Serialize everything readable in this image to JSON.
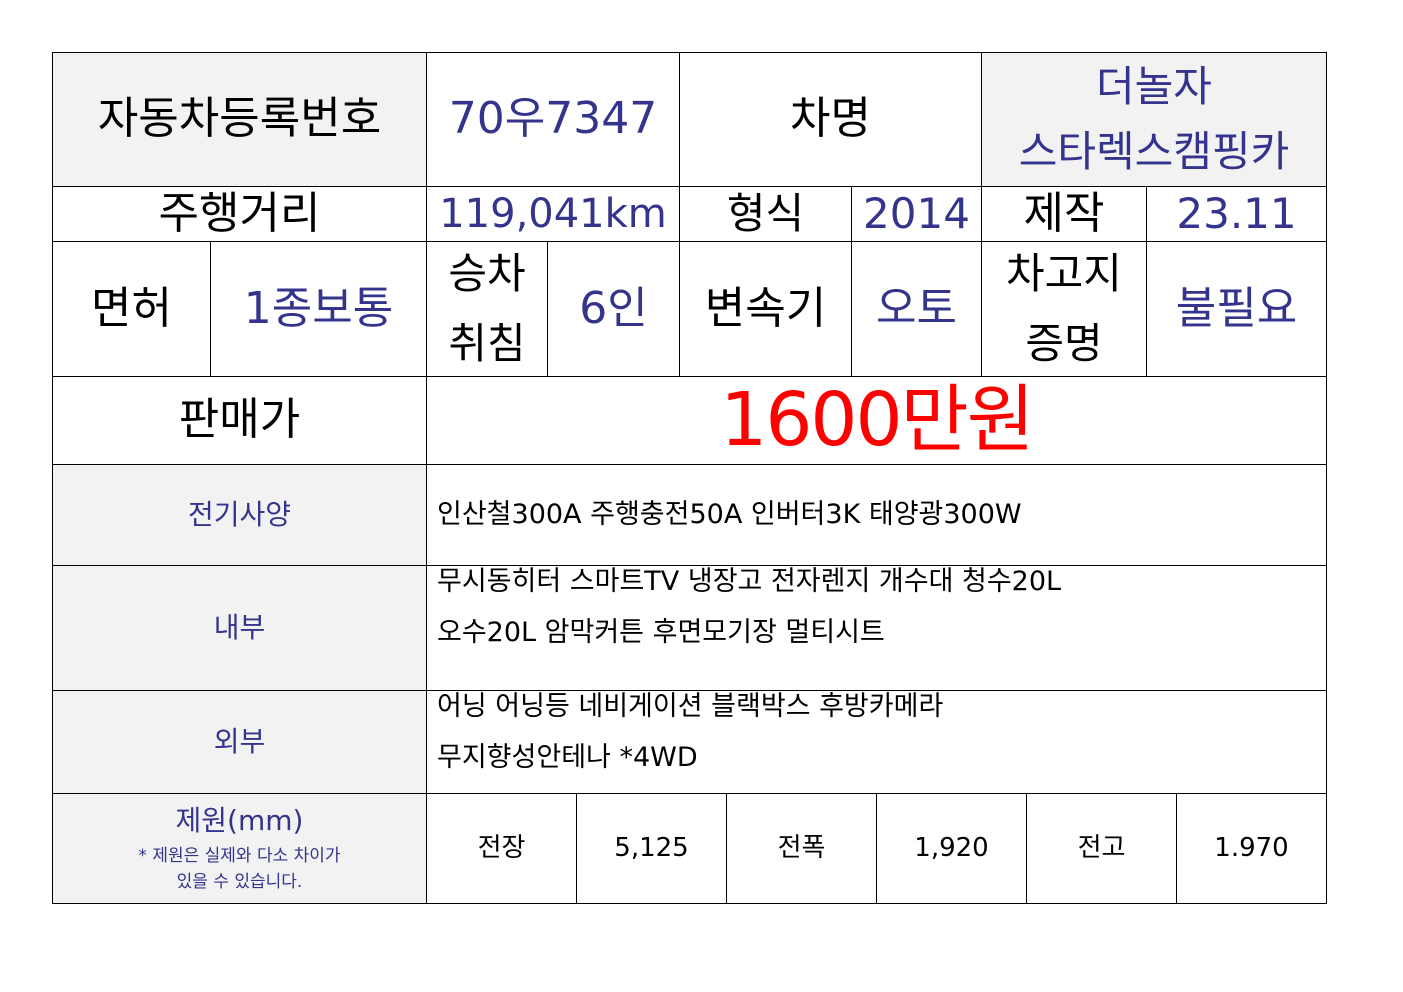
{
  "header": {
    "reg_label": "자동차등록번호",
    "reg_value": "70우7347",
    "name_label": "차명",
    "name_value_line1": "더놀자",
    "name_value_line2": "스타렉스캠핑카"
  },
  "row2": {
    "mileage_label": "주행거리",
    "mileage_value": "119,041km",
    "type_label": "형식",
    "type_value": "2014",
    "made_label": "제작",
    "made_value": "23.11"
  },
  "row3": {
    "license_label": "면허",
    "license_value": "1종보통",
    "seats_label_line1": "승차",
    "seats_label_line2": "취침",
    "seats_value": "6인",
    "trans_label": "변속기",
    "trans_value": "오토",
    "garage_label_line1": "차고지",
    "garage_label_line2": "증명",
    "garage_value": "불필요"
  },
  "price": {
    "label": "판매가",
    "value": "1600만원"
  },
  "specs": {
    "electric_label": "전기사양",
    "electric_value": "인산철300A 주행충전50A 인버터3K 태양광300W",
    "interior_label": "내부",
    "interior_line1": "무시동히터 스마트TV 냉장고 전자렌지 개수대 청수20L",
    "interior_line2": "오수20L 암막커튼 후면모기장 멀티시트",
    "exterior_label": "외부",
    "exterior_line1": "어닝 어닝등 네비게이션 블랙박스 후방카메라",
    "exterior_line2": "무지향성안테나 *4WD"
  },
  "dimensions": {
    "label": "제원(mm)",
    "note_line1": "* 제원은 실제와 다소 차이가",
    "note_line2": "있을 수 있습니다.",
    "length_label": "전장",
    "length_value": "5,125",
    "width_label": "전폭",
    "width_value": "1,920",
    "height_label": "전고",
    "height_value": "1.970"
  },
  "colors": {
    "label_bg": "#f2f2f2",
    "value_text": "#34348c",
    "price_text": "#ff0000"
  }
}
